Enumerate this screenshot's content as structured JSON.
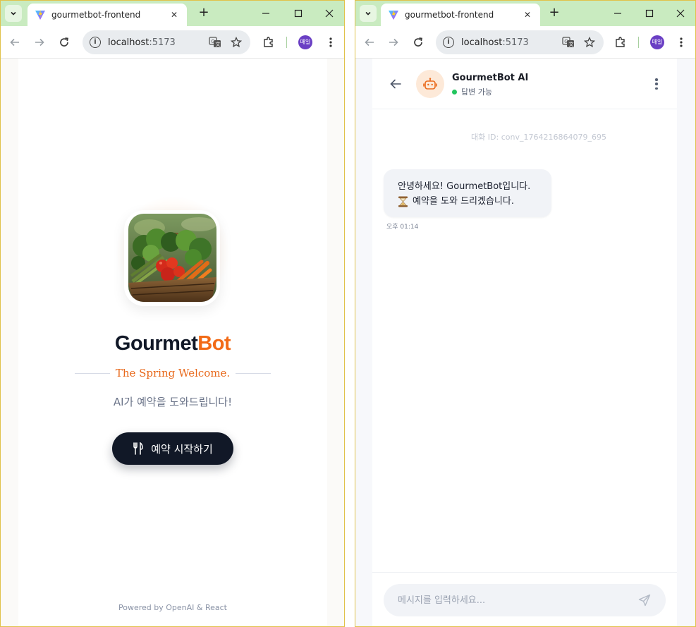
{
  "left_window": {
    "tab": {
      "title": "gourmetbot-frontend"
    },
    "url": {
      "host": "localhost",
      "port": ":5173"
    },
    "profile_label": "매일",
    "page": {
      "brand": {
        "part1": "Gourmet",
        "part2": "Bot"
      },
      "tagline": "The Spring Welcome.",
      "subtitle": "AI가 예약을 도와드립니다!",
      "cta_label": "예약 시작하기",
      "footer": "Powered by OpenAI & React"
    }
  },
  "right_window": {
    "tab": {
      "title": "gourmetbot-frontend"
    },
    "url": {
      "host": "localhost",
      "port": ":5173"
    },
    "profile_label": "매일",
    "chat": {
      "bot_name": "GourmetBot AI",
      "status": "답변 가능",
      "conversation_id": "대화 ID: conv_1764216864079_695",
      "messages": [
        {
          "line1": "안녕하세요! GourmetBot입니다.",
          "line2": "예약을 도와 드리겠습니다.",
          "time": "오후 01:14"
        }
      ],
      "input_placeholder": "메시지를 입력하세요..."
    }
  },
  "colors": {
    "brand_orange": "#f26a16",
    "cta_dark": "#111827",
    "status_green": "#22c55e",
    "tab_strip": "#c9ebc0"
  },
  "icons": [
    "vite-favicon",
    "back-icon",
    "forward-icon",
    "reload-icon",
    "info-icon",
    "translate-icon",
    "star-icon",
    "extensions-icon",
    "fork-knife-icon",
    "robot-icon",
    "hourglass-icon",
    "send-icon",
    "kebab-icon"
  ]
}
